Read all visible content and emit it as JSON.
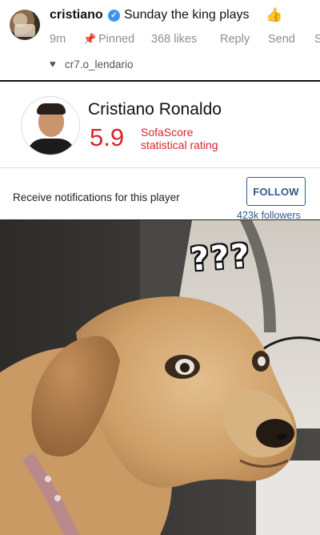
{
  "comment": {
    "username": "cristiano",
    "text": "Sunday the king plays",
    "thumb_emoji": "👍",
    "time": "9m",
    "pinned_label": "Pinned",
    "likes": "368 likes",
    "reply_label": "Reply",
    "send_label": "Send",
    "cut_label": "S",
    "liked_by": "cr7.o_lendario",
    "verified_color": "#3897f0"
  },
  "player_card": {
    "name": "Cristiano Ronaldo",
    "rating": "5.9",
    "rating_label_line1": "SofaScore",
    "rating_label_line2": "statistical rating",
    "notifications_text": "Receive notifications for this player",
    "follow_label": "FOLLOW",
    "followers": "423k followers",
    "rating_color": "#d9252b",
    "accent_color": "#2f5a8b"
  },
  "meme": {
    "overlay_text": "???"
  }
}
